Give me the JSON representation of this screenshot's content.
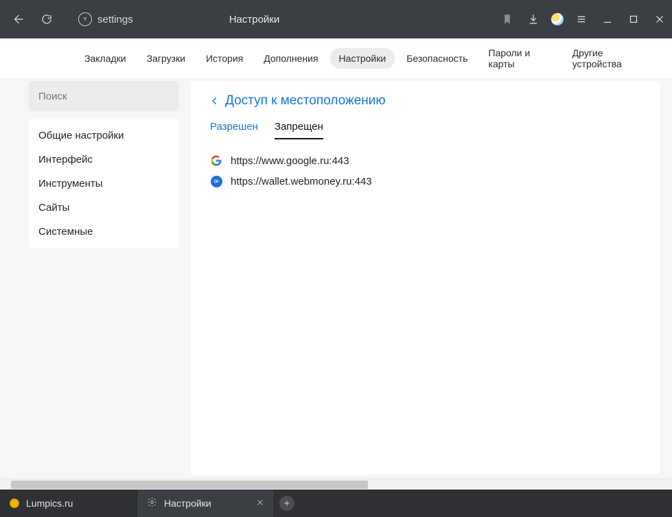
{
  "titlebar": {
    "address": "settings",
    "title": "Настройки"
  },
  "topnav": {
    "items": [
      {
        "label": "Закладки"
      },
      {
        "label": "Загрузки"
      },
      {
        "label": "История"
      },
      {
        "label": "Дополнения"
      },
      {
        "label": "Настройки"
      },
      {
        "label": "Безопасность"
      },
      {
        "label": "Пароли и карты"
      },
      {
        "label": "Другие устройства"
      }
    ],
    "active_index": 4
  },
  "sidebar": {
    "search_placeholder": "Поиск",
    "items": [
      {
        "label": "Общие настройки"
      },
      {
        "label": "Интерфейс"
      },
      {
        "label": "Инструменты"
      },
      {
        "label": "Сайты"
      },
      {
        "label": "Системные"
      }
    ]
  },
  "page": {
    "heading": "Доступ к местоположению",
    "tabs": [
      {
        "label": "Разрешен"
      },
      {
        "label": "Запрещен"
      }
    ],
    "active_tab_index": 1,
    "sites": [
      {
        "icon": "google",
        "url": "https://www.google.ru:443"
      },
      {
        "icon": "webmoney",
        "url": "https://wallet.webmoney.ru:443"
      }
    ]
  },
  "tabs": {
    "items": [
      {
        "icon": "lumpics",
        "label": "Lumpics.ru"
      },
      {
        "icon": "gear",
        "label": "Настройки"
      }
    ],
    "active_index": 1
  }
}
